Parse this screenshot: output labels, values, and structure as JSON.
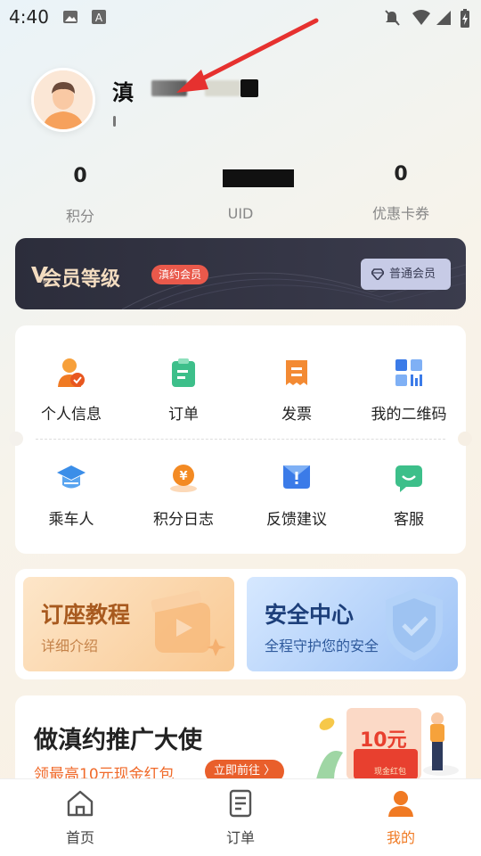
{
  "status_bar": {
    "time": "4:40"
  },
  "profile": {
    "name_prefix": "滇"
  },
  "stats": [
    {
      "value": "0",
      "label": "积分"
    },
    {
      "value": "",
      "label": "UID"
    },
    {
      "value": "0",
      "label": "优惠卡券"
    }
  ],
  "membership": {
    "title": "会员等级",
    "badge": "滇约会员",
    "level_button": "普通会员"
  },
  "grid": [
    {
      "label": "个人信息",
      "icon": "person-info-icon"
    },
    {
      "label": "订单",
      "icon": "order-clipboard-icon"
    },
    {
      "label": "发票",
      "icon": "invoice-icon"
    },
    {
      "label": "我的二维码",
      "icon": "qr-code-icon"
    },
    {
      "label": "乘车人",
      "icon": "passenger-icon"
    },
    {
      "label": "积分日志",
      "icon": "points-log-icon"
    },
    {
      "label": "反馈建议",
      "icon": "feedback-icon"
    },
    {
      "label": "客服",
      "icon": "customer-service-icon"
    }
  ],
  "promos": [
    {
      "title": "订座教程",
      "subtitle": "详细介绍"
    },
    {
      "title": "安全中心",
      "subtitle": "全程守护您的安全"
    }
  ],
  "ambassador": {
    "title": "做滇约推广大使",
    "subtitle": "领最高10元现金红包",
    "button": "立即前往 〉",
    "amount": "10元",
    "ticket": "现金红包"
  },
  "bottom_nav": [
    {
      "label": "首页",
      "active": false
    },
    {
      "label": "订单",
      "active": false
    },
    {
      "label": "我的",
      "active": true
    }
  ],
  "colors": {
    "accent": "#f07a23",
    "nav_active": "#f07a23",
    "member_bg": "#2c2d3b"
  }
}
